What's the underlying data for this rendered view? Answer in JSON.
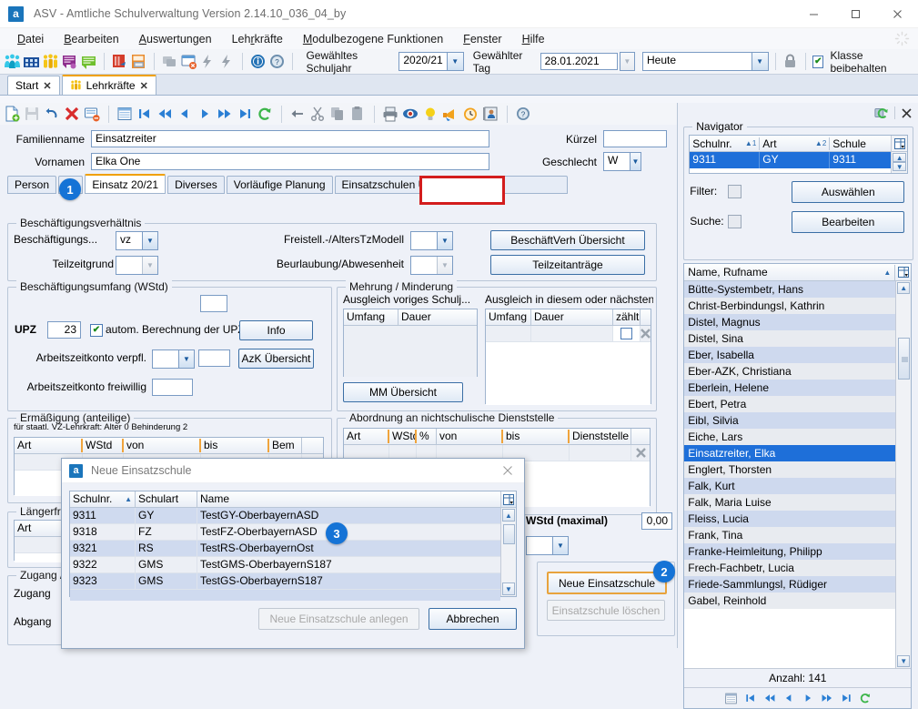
{
  "window": {
    "title": "ASV - Amtliche Schulverwaltung Version 2.14.10_036_04_by",
    "app_icon_letter": "a",
    "minimize": "—",
    "maximize": "❐",
    "close": "✕"
  },
  "menubar": {
    "items": [
      {
        "label": "Datei",
        "accel": "D"
      },
      {
        "label": "Bearbeiten",
        "accel": "B"
      },
      {
        "label": "Auswertungen",
        "accel": "A"
      },
      {
        "label": "Lehrkräfte",
        "accel": "r"
      },
      {
        "label": "Modulbezogene Funktionen",
        "accel": "M"
      },
      {
        "label": "Fenster",
        "accel": "F"
      },
      {
        "label": "Hilfe",
        "accel": "H"
      }
    ]
  },
  "main_toolbar": {
    "icons": [
      "students-group-icon",
      "school-building-icon",
      "teachers-group-icon",
      "reports-purple-icon",
      "reports-green-icon",
      "book-red-icon",
      "printlist-icon",
      "modules-icon",
      "window-close-icon",
      "lightning-icon",
      "lightning2-icon",
      "info-icon",
      "help-icon"
    ],
    "schuljahr_label": "Gewähltes Schuljahr",
    "schuljahr_value": "2020/21",
    "tag_label": "Gewählter Tag",
    "tag_value": "28.01.2021",
    "zeitraum_value": "Heute",
    "lock-icon": "lock-icon",
    "klasse_checkbox_label": "Klasse beibehalten",
    "klasse_checkbox_checked": "✔"
  },
  "tabs": [
    {
      "label": "Start",
      "close": "✕",
      "icon": null,
      "active": false
    },
    {
      "label": "Lehrkräfte",
      "close": "✕",
      "icon": "teachers-icon",
      "active": true
    }
  ],
  "form_toolbar": {
    "icons": [
      "new-icon",
      "save-icon",
      "undo-icon",
      "delete-icon",
      "record-delete-icon",
      "table-icon",
      "first-icon",
      "prev-fast-icon",
      "prev-icon",
      "next-icon",
      "next-fast-icon",
      "last-icon",
      "refresh-icon",
      "back-icon",
      "cut-icon",
      "copy-icon",
      "paste-icon",
      "print-icon",
      "preview-icon",
      "idea-icon",
      "megaphone-icon",
      "clock-icon",
      "contact-icon",
      "help-icon"
    ]
  },
  "person": {
    "familienname_label": "Familienname",
    "familienname_value": "Einsatzreiter",
    "vornamen_label": "Vornamen",
    "vornamen_value": "Elka One",
    "kuerzel_label": "Kürzel",
    "kuerzel_value": "",
    "geschlecht_label": "Geschlecht",
    "geschlecht_value": "W"
  },
  "subtabs": [
    {
      "label": "Person"
    },
    {
      "label": "Di"
    },
    {
      "label": "Einsatz 20/21",
      "active": true
    },
    {
      "label": "Diverses"
    },
    {
      "label": "Vorläufige Planung"
    },
    {
      "label": "Einsatzschulen Übersicht"
    }
  ],
  "beschaeftigungsverhaeltnis": {
    "title": "Beschäftigungsverhältnis",
    "beschaeftigungs_label": "Beschäftigungs...",
    "beschaeftigungs_value": "vz",
    "teilzeitgrund_label": "Teilzeitgrund",
    "teilzeitgrund_value": "",
    "freistell_label": "Freistell.-/AltersTzModell",
    "freistell_value": "",
    "beurlaubung_label": "Beurlaubung/Abwesenheit",
    "beurlaubung_value": "",
    "btn_beschaeftverh": "BeschäftVerh Übersicht",
    "btn_teilzeitantraege": "Teilzeitanträge"
  },
  "beschaeftigungsumfang": {
    "title": "Beschäftigungsumfang (WStd)",
    "top_field_value": "",
    "upz_label": "UPZ",
    "upz_value": "23",
    "autom_label": "autom. Berechnung der UPZ",
    "autom_checked": "✔",
    "btn_info": "Info",
    "azk_verpfl_label": "Arbeitszeitkonto verpfl.",
    "azk_verpfl_value": "",
    "azk_verpfl_value2": "",
    "btn_azk": "AzK Übersicht",
    "azk_freiwillig_label": "Arbeitszeitkonto freiwillig",
    "azk_freiwillig_value": ""
  },
  "mehrung_minderung": {
    "title": "Mehrung / Minderung",
    "left_label": "Ausgleich voriges Schulj...",
    "left_columns": [
      "Umfang",
      "Dauer"
    ],
    "right_label": "Ausgleich in diesem oder nächsten Sc...",
    "right_columns": [
      "Umfang",
      "Dauer",
      "zählt",
      ""
    ],
    "btn_mm": "MM Übersicht",
    "delete_icon": "delete-row-icon"
  },
  "ermaessigung": {
    "title": "Ermäßigung (anteilige)",
    "subtitle": "für staatl. VZ-Lehrkraft: Alter 0 Behinderung 2",
    "columns": [
      "Art",
      "WStd",
      "von",
      "bis",
      "Bem",
      ""
    ]
  },
  "abordnung": {
    "title": "Abordnung an nichtschulische Dienststelle",
    "columns": [
      "Art",
      "WStd",
      "%",
      "von",
      "bis",
      "Dienststelle",
      ""
    ],
    "delete_icon": "delete-row-icon"
  },
  "laengerfristig": {
    "title": "Längerfri",
    "columns": [
      "Art"
    ]
  },
  "zugang_abgang": {
    "title": "Zugang /",
    "zugang_label": "Zugang",
    "abgang_label": "Abgang"
  },
  "einsatzschulen": {
    "wstd_maximal_label": "WStd (maximal)",
    "wstd_maximal_value": "0,00",
    "btn_neue": "Neue Einsatzschule",
    "btn_loeschen": "Einsatzschule löschen"
  },
  "dialog": {
    "title": "Neue Einsatzschule",
    "app_icon_letter": "a",
    "close": "✕",
    "columns": [
      "Schulnr.",
      "Schulart",
      "Name"
    ],
    "sort_indicator": "▲",
    "grid_menu_icon": "grid-settings-icon",
    "rows": [
      {
        "schulnr": "9311",
        "schulart": "GY",
        "name": "TestGY-OberbayernASD"
      },
      {
        "schulnr": "9318",
        "schulart": "FZ",
        "name": "TestFZ-OberbayernASD"
      },
      {
        "schulnr": "9321",
        "schulart": "RS",
        "name": "TestRS-OberbayernOst"
      },
      {
        "schulnr": "9322",
        "schulart": "GMS",
        "name": "TestGMS-OberbayernS187"
      },
      {
        "schulnr": "9323",
        "schulart": "GMS",
        "name": "TestGS-OberbayernS187"
      }
    ],
    "btn_anlegen": "Neue Einsatzschule anlegen",
    "btn_abbrechen": "Abbrechen"
  },
  "navigator": {
    "title": "Navigator",
    "refresh_icon": "refresh-icon",
    "close_icon": "close-icon",
    "columns": [
      {
        "label": "Schulnr.",
        "sort": "▲",
        "order": "1"
      },
      {
        "label": "Art",
        "sort": "▲",
        "order": "2"
      },
      {
        "label": "Schule",
        "sort": "",
        "order": ""
      }
    ],
    "grid_menu_icon": "grid-settings-icon",
    "row": {
      "schulnr": "9311",
      "art": "GY",
      "schule": "9311"
    },
    "filter_label": "Filter:",
    "suche_label": "Suche:",
    "btn_auswaehlen": "Auswählen",
    "btn_bearbeiten": "Bearbeiten",
    "list_header": "Name, Rufname",
    "list_sort": "▲",
    "items": [
      "Bütte-Systembetr, Hans",
      "Christ-Berbindungsl, Kathrin",
      "Distel, Magnus",
      "Distel, Sina",
      "Eber, Isabella",
      "Eber-AZK, Christiana",
      "Eberlein, Helene",
      "Ebert, Petra",
      "Eibl, Silvia",
      "Eiche, Lars",
      "Einsatzreiter, Elka",
      "Englert, Thorsten",
      "Falk, Kurt",
      "Falk, Maria Luise",
      "Fleiss, Lucia",
      "Frank, Tina",
      "Franke-Heimleitung, Philipp",
      "Frech-Fachbetr, Lucia",
      "Friede-Sammlungsl, Rüdiger",
      "Gabel, Reinhold"
    ],
    "selected_item": "Einsatzreiter, Elka",
    "count_label": "Anzahl: 141",
    "nav_icons": [
      "table-icon",
      "first-icon",
      "prev-fast-icon",
      "prev-icon",
      "next-icon",
      "next-fast-icon",
      "last-icon",
      "refresh-icon"
    ]
  },
  "callouts": [
    {
      "number": "1"
    },
    {
      "number": "2"
    },
    {
      "number": "3"
    }
  ],
  "colors": {
    "accent_blue": "#1573d6",
    "selection_blue": "#1e6fd9",
    "highlight_orange": "#e8a33d",
    "red_box": "#d31d1d",
    "panel_bg": "#eef1f8"
  }
}
